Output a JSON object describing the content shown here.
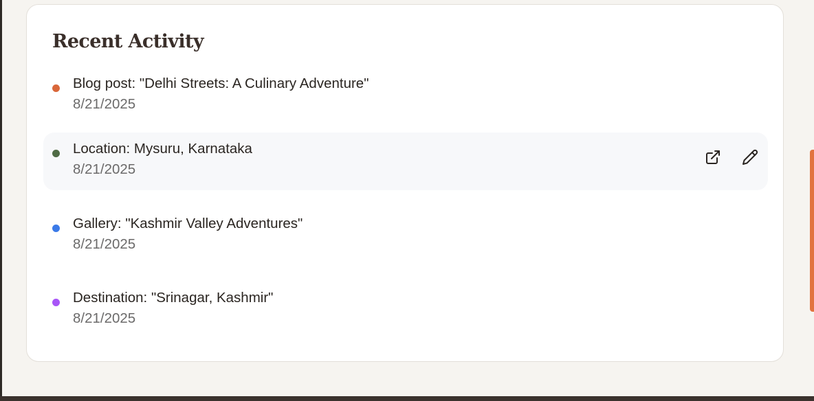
{
  "recent_activity": {
    "title": "Recent Activity",
    "items": [
      {
        "title": "Blog post: \"Delhi Streets: A Culinary Adventure\"",
        "date": "8/21/2025",
        "dot_color": "#d9673a"
      },
      {
        "title": "Location: Mysuru, Karnataka",
        "date": "8/21/2025",
        "dot_color": "#4f6b45",
        "actions": [
          {
            "icon": "external-link-icon"
          },
          {
            "icon": "pencil-icon"
          }
        ]
      },
      {
        "title": "Gallery: \"Kashmir Valley Adventures\"",
        "date": "8/21/2025",
        "dot_color": "#3b7ae8"
      },
      {
        "title": "Destination: \"Srinagar, Kashmir\"",
        "date": "8/21/2025",
        "dot_color": "#a855f7"
      }
    ]
  },
  "colors": {
    "page_background": "#f6f4f0",
    "card_background": "#ffffff",
    "hover_row_background": "#f7f8fa",
    "accent": "#e2733f"
  }
}
